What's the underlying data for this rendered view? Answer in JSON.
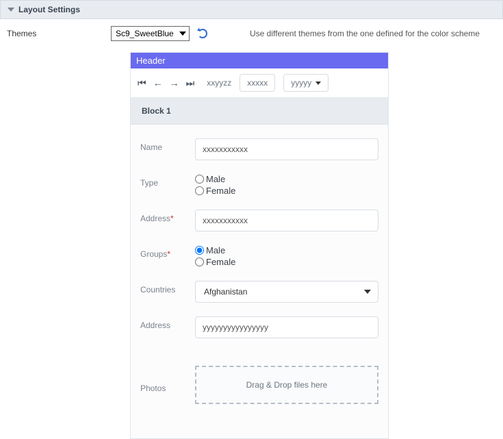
{
  "section": {
    "title": "Layout Settings"
  },
  "themes": {
    "label": "Themes",
    "value": "Sc9_SweetBlue",
    "hint": "Use different themes from the one defined for the color scheme"
  },
  "preview": {
    "header": "Header",
    "breadcrumb": "xxyyzz",
    "pill1": "xxxxx",
    "pill2": "yyyyy",
    "block_title": "Block 1",
    "fields": {
      "name": {
        "label": "Name",
        "value": "xxxxxxxxxxx"
      },
      "type": {
        "label": "Type",
        "opt1": "Male",
        "opt2": "Female"
      },
      "address_req": {
        "label": "Address",
        "value": "xxxxxxxxxxx"
      },
      "groups": {
        "label": "Groups",
        "opt1": "Male",
        "opt2": "Female"
      },
      "countries": {
        "label": "Countries",
        "value": "Afghanistan"
      },
      "address2": {
        "label": "Address",
        "value": "yyyyyyyyyyyyyyyy"
      },
      "photos": {
        "label": "Photos",
        "dropzone": "Drag & Drop files here"
      }
    }
  },
  "required_marker": "*"
}
